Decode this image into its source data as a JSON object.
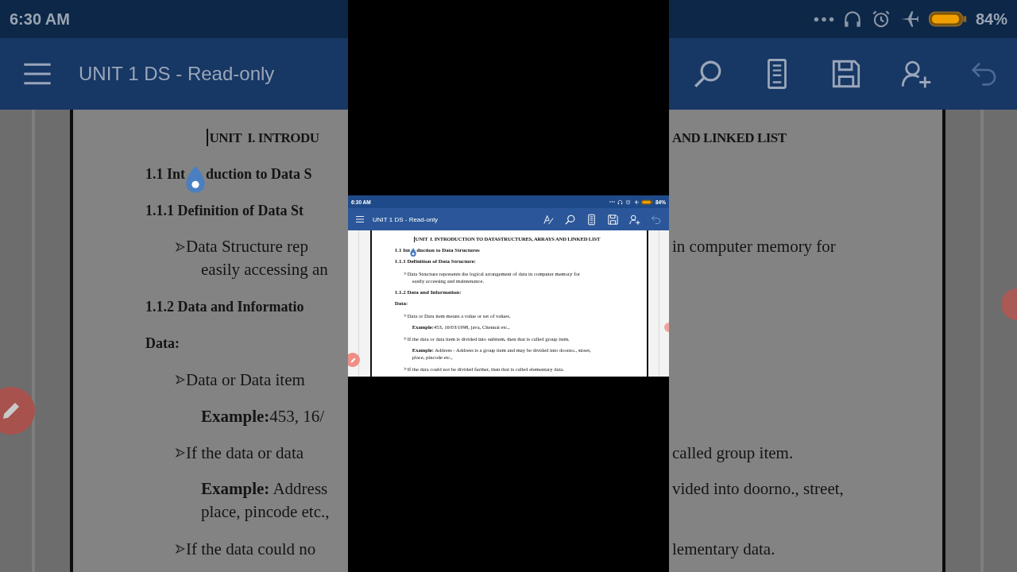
{
  "backdrop": {
    "status_bar": {
      "time": "6:30 AM",
      "battery_text": "84%"
    },
    "app_bar": {
      "title": "UNIT 1 DS - Read-only"
    },
    "rows": [
      {
        "kind": "title",
        "left": [
          "UNIT  I. INTRODU"
        ],
        "right": [
          "AND LINKED LIST"
        ]
      },
      {
        "kind": "heading_marked",
        "left": [
          "1.1 Int",
          "duction to Data S"
        ]
      },
      {
        "kind": "heading",
        "left": [
          "1.1.1 Definition of Data St"
        ]
      },
      {
        "kind": "bullet",
        "left": [
          "Data Structure rep",
          "easily accessing an"
        ],
        "right": [
          "in computer memory for"
        ]
      },
      {
        "kind": "heading",
        "left": [
          "1.1.2 Data and Informatio"
        ]
      },
      {
        "kind": "label",
        "left": [
          "Data:"
        ]
      },
      {
        "kind": "bullet",
        "left": [
          "Data or Data item"
        ]
      },
      {
        "kind": "example",
        "left": [
          "**Example:**453, 16/"
        ]
      },
      {
        "kind": "bullet",
        "left": [
          "If the data or data"
        ],
        "right": [
          "called group item."
        ]
      },
      {
        "kind": "example",
        "left": [
          "**Example:** Address",
          "place, pincode etc.,"
        ],
        "right": [
          "vided into doorno., street,"
        ]
      },
      {
        "kind": "bullet",
        "left": [
          "If the data could no"
        ],
        "right": [
          "lementary data."
        ]
      }
    ]
  },
  "screen": {
    "status_bar": {
      "time": "6:30 AM",
      "battery_text": "84%"
    },
    "app_bar": {
      "title": "UNIT 1 DS - Read-only"
    },
    "rows": [
      {
        "kind": "title",
        "left": [
          "UNIT  I. INTRODUCTION TO DATASTRUCTURES, ARRAYS AND LINKED LIST"
        ]
      },
      {
        "kind": "heading_marked",
        "left": [
          "1.1 Int",
          "duction to Data Structures"
        ]
      },
      {
        "kind": "heading",
        "left": [
          "1.1.1 Definition of Data Structure:"
        ]
      },
      {
        "kind": "bullet",
        "left": [
          "Data Structure represents the logical arrangement of data in computer memory for",
          "easily accessing and maintenance."
        ]
      },
      {
        "kind": "heading",
        "left": [
          "1.1.2 Data and Information:"
        ]
      },
      {
        "kind": "label",
        "left": [
          "Data:"
        ]
      },
      {
        "kind": "bullet",
        "left": [
          "Data or Data item means a value or set of values."
        ]
      },
      {
        "kind": "example",
        "left": [
          "**Example:**453, 16/03/1998, java, Chennai etc.,"
        ]
      },
      {
        "kind": "bullet",
        "left": [
          "If the data or data item is divided into subitem, then that is called group item."
        ]
      },
      {
        "kind": "example",
        "left": [
          "**Example:** Address - Address is a group item and may be divided into doorno., street,",
          "place, pincode etc.,"
        ]
      },
      {
        "kind": "bullet",
        "left": [
          "If the data could not be divided further, then that is called elementary data."
        ]
      }
    ]
  }
}
